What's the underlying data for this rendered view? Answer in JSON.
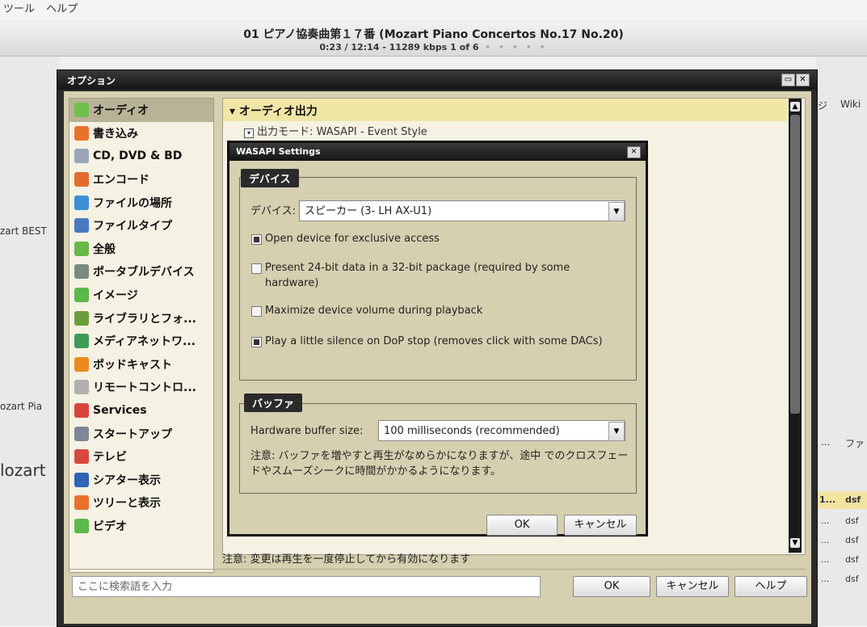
{
  "menubar": {
    "items": [
      "ツール",
      "ヘルプ"
    ]
  },
  "player": {
    "title": "01 ピアノ協奏曲第１７番 (Mozart Piano Concertos No.17 No.20)",
    "info": "0:23 / 12:14 - 11289 kbps   1 of 6",
    "dots": "• • • • •"
  },
  "background": {
    "left_text_1": "zart BEST",
    "left_text_2": "ozart Pia",
    "left_big": "lozart",
    "right_tab_1": "ジ",
    "right_tab_2": "Wiki",
    "right_col_1": "...",
    "right_col_2": "ファ",
    "right_header_a": "1...",
    "right_header_b": "dsf",
    "right_rows": [
      "...",
      "...",
      "...",
      "..."
    ],
    "right_rows_dsf": [
      "dsf",
      "dsf",
      "dsf",
      "dsf"
    ]
  },
  "options_window": {
    "title": "オプション",
    "sidebar": [
      {
        "label": "オーディオ",
        "icon": "speaker-icon",
        "color": "#6fc04a",
        "selected": true
      },
      {
        "label": "書き込み",
        "icon": "burn-icon",
        "color": "#e8722a"
      },
      {
        "label": "CD, DVD & BD",
        "icon": "disc-icon",
        "color": "#9aa6b8"
      },
      {
        "label": "エンコード",
        "icon": "encode-icon",
        "color": "#e56b2b"
      },
      {
        "label": "ファイルの場所",
        "icon": "globe-icon",
        "color": "#3a8fd6"
      },
      {
        "label": "ファイルタイプ",
        "icon": "filetype-icon",
        "color": "#4c7ac2"
      },
      {
        "label": "全般",
        "icon": "general-icon",
        "color": "#69b84a"
      },
      {
        "label": "ポータブルデバイス",
        "icon": "portable-device-icon",
        "color": "#7a8a80"
      },
      {
        "label": "イメージ",
        "icon": "image-icon",
        "color": "#5bb84a"
      },
      {
        "label": "ライブラリとフォ...",
        "icon": "library-icon",
        "color": "#6a9f3b"
      },
      {
        "label": "メディアネットワ...",
        "icon": "network-icon",
        "color": "#3e9c57"
      },
      {
        "label": "ポッドキャスト",
        "icon": "podcast-icon",
        "color": "#ec8b1f"
      },
      {
        "label": "リモートコントロ...",
        "icon": "remote-icon",
        "color": "#b0b0b0"
      },
      {
        "label": "Services",
        "icon": "services-icon",
        "color": "#d8463c"
      },
      {
        "label": "スタートアップ",
        "icon": "startup-icon",
        "color": "#7d8797"
      },
      {
        "label": "テレビ",
        "icon": "tv-icon",
        "color": "#d9483c"
      },
      {
        "label": "シアター表示",
        "icon": "theater-icon",
        "color": "#2f64b6"
      },
      {
        "label": "ツリーと表示",
        "icon": "tree-icon",
        "color": "#e8702a"
      },
      {
        "label": "ビデオ",
        "icon": "video-icon",
        "color": "#5bb84a"
      }
    ],
    "panel_header": "オーディオ出力",
    "output_mode": "出力モード: WASAPI - Event Style",
    "note": "注意: 変更は再生を一度停止してから有効になります",
    "search_placeholder": "ここに検索語を入力",
    "ok": "OK",
    "cancel": "キャンセル",
    "help": "ヘルプ"
  },
  "wasapi": {
    "title": "WASAPI Settings",
    "device_group": "デバイス",
    "device_label": "デバイス:",
    "device_value": "スピーカー (3- LH AX-U1)",
    "options": [
      {
        "text": "Open device for exclusive access",
        "checked": true
      },
      {
        "text": "Present 24-bit data in a 32-bit package (required by some hardware)",
        "checked": false
      },
      {
        "text": "Maximize device volume during playback",
        "checked": false
      },
      {
        "text": "Play a little silence on DoP stop (removes click with some DACs)",
        "checked": true
      }
    ],
    "buffer_group": "バッファ",
    "buffer_label": "Hardware buffer size:",
    "buffer_value": "100 milliseconds (recommended)",
    "buffer_note": "注意: バッファを増やすと再生がなめらかになりますが、途中 でのクロスフェードやスムーズシークに時間がかかるようになります。",
    "ok": "OK",
    "cancel": "キャンセル"
  }
}
